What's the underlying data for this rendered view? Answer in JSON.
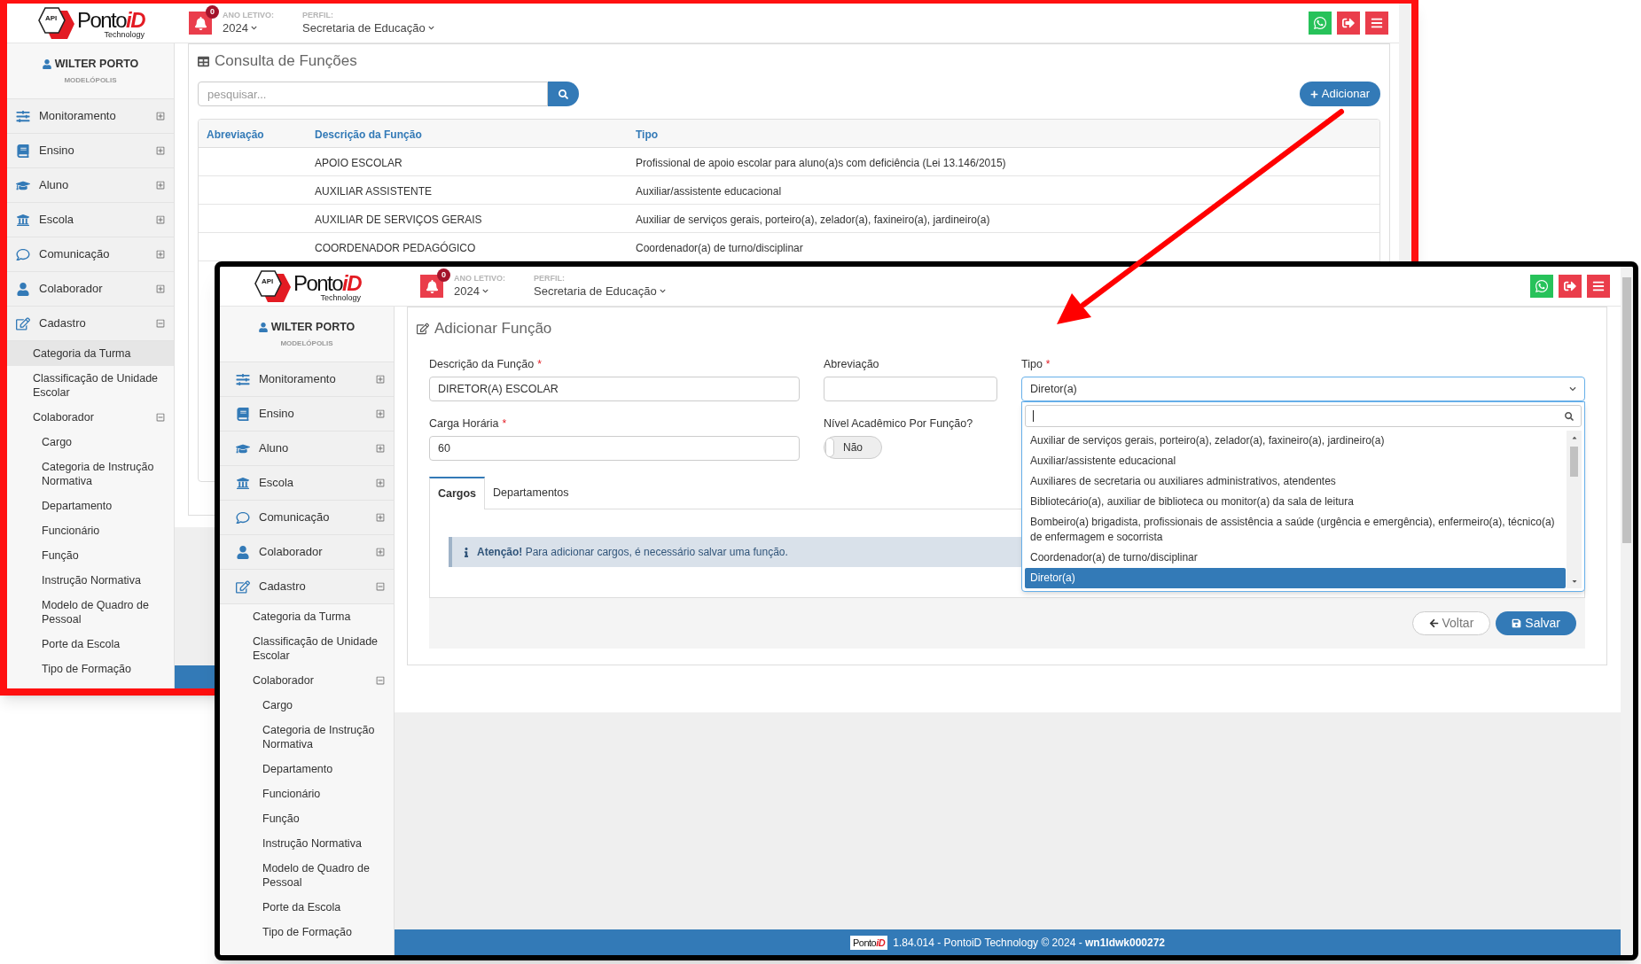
{
  "back_window": {
    "header": {
      "logo": {
        "badge": "API",
        "brand": "Ponto",
        "brand_accent": "iD",
        "tagline": "Technology"
      },
      "notifications": "0",
      "year_label": "ANO LETIVO:",
      "year": "2024",
      "profile_label": "PERFIL:",
      "profile": "Secretaria de Educação"
    },
    "user": {
      "name": "WILTER PORTO",
      "city": "MODELÓPOLIS"
    },
    "sidebar": {
      "items": [
        {
          "label": "Monitoramento",
          "expanded": false
        },
        {
          "label": "Ensino",
          "expanded": false
        },
        {
          "label": "Aluno",
          "expanded": false
        },
        {
          "label": "Escola",
          "expanded": false
        },
        {
          "label": "Comunicação",
          "expanded": false
        },
        {
          "label": "Colaborador",
          "expanded": false
        },
        {
          "label": "Cadastro",
          "expanded": true,
          "children": [
            {
              "label": "Categoria da Turma",
              "selected": true
            },
            {
              "label": "Classificação de Unidade Escolar",
              "selected": false
            },
            {
              "label": "Colaborador",
              "selected": false,
              "expanded": true,
              "children": [
                {
                  "label": "Cargo",
                  "selected": false
                },
                {
                  "label": "Categoria de Instrução Normativa",
                  "selected": false
                },
                {
                  "label": "Departamento",
                  "selected": false
                },
                {
                  "label": "Funcionário",
                  "selected": false
                },
                {
                  "label": "Função",
                  "selected": false
                },
                {
                  "label": "Instrução Normativa",
                  "selected": false
                },
                {
                  "label": "Modelo de Quadro de Pessoal",
                  "selected": false
                },
                {
                  "label": "Porte da Escola",
                  "selected": false
                },
                {
                  "label": "Tipo de Formação",
                  "selected": false
                }
              ]
            }
          ]
        }
      ]
    },
    "page": {
      "title": "Consulta de Funções",
      "search": {
        "placeholder": "pesquisar..."
      },
      "add_button": "Adicionar",
      "table": {
        "columns": [
          "Abreviação",
          "Descrição da Função",
          "Tipo"
        ],
        "rows": [
          {
            "description": "APOIO ESCOLAR",
            "type": "Profissional de apoio escolar para aluno(a)s com deficiência (Lei 13.146/2015)"
          },
          {
            "description": "AUXILIAR ASSISTENTE",
            "type": "Auxiliar/assistente educacional"
          },
          {
            "description": "AUXILIAR DE SERVIÇOS GERAIS",
            "type": "Auxiliar de serviços gerais, porteiro(a), zelador(a), faxineiro(a), jardineiro(a)"
          },
          {
            "description": "COORDENADOR PEDAGÓGICO",
            "type": "Coordenador(a) de turno/disciplinar"
          }
        ]
      }
    }
  },
  "front_window": {
    "header": {
      "logo": {
        "badge": "API",
        "brand": "Ponto",
        "brand_accent": "iD",
        "tagline": "Technology"
      },
      "notifications": "0",
      "year_label": "ANO LETIVO:",
      "year": "2024",
      "profile_label": "PERFIL:",
      "profile": "Secretaria de Educação"
    },
    "user": {
      "name": "WILTER PORTO",
      "city": "MODELÓPOLIS"
    },
    "sidebar": {
      "items": [
        {
          "label": "Monitoramento",
          "expanded": false
        },
        {
          "label": "Ensino",
          "expanded": false
        },
        {
          "label": "Aluno",
          "expanded": false
        },
        {
          "label": "Escola",
          "expanded": false
        },
        {
          "label": "Comunicação",
          "expanded": false
        },
        {
          "label": "Colaborador",
          "expanded": false
        },
        {
          "label": "Cadastro",
          "expanded": true,
          "children": [
            {
              "label": "Categoria da Turma",
              "selected": false
            },
            {
              "label": "Classificação de Unidade Escolar",
              "selected": false
            },
            {
              "label": "Colaborador",
              "selected": false,
              "expanded": true,
              "children": [
                {
                  "label": "Cargo",
                  "selected": false
                },
                {
                  "label": "Categoria de Instrução Normativa",
                  "selected": false
                },
                {
                  "label": "Departamento",
                  "selected": false
                },
                {
                  "label": "Funcionário",
                  "selected": false
                },
                {
                  "label": "Função",
                  "selected": false
                },
                {
                  "label": "Instrução Normativa",
                  "selected": false
                },
                {
                  "label": "Modelo de Quadro de Pessoal",
                  "selected": false
                },
                {
                  "label": "Porte da Escola",
                  "selected": false
                },
                {
                  "label": "Tipo de Formação",
                  "selected": false
                }
              ]
            }
          ]
        }
      ]
    },
    "page": {
      "title": "Adicionar Função",
      "description_field": {
        "label": "Descrição da Função",
        "required_mark": "*",
        "value": "DIRETOR(A) ESCOLAR"
      },
      "abbreviation_field": {
        "label": "Abreviação"
      },
      "type_select": {
        "label": "Tipo",
        "required_mark": "*",
        "value": "Diretor(a)",
        "expanded": true,
        "options": [
          {
            "label": "Auxiliar de serviços gerais, porteiro(a), zelador(a), faxineiro(a), jardineiro(a)",
            "selected": false
          },
          {
            "label": "Auxiliar/assistente educacional",
            "selected": false
          },
          {
            "label": "Auxiliares de secretaria ou auxiliares administrativos, atendentes",
            "selected": false
          },
          {
            "label": "Bibliotecário(a), auxiliar de biblioteca ou monitor(a) da sala de leitura",
            "selected": false
          },
          {
            "label": "Bombeiro(a) brigadista, profissionais de assistência a saúde (urgência e emergência), enfermeiro(a), técnico(a) de enfermagem e socorrista",
            "selected": false
          },
          {
            "label": "Coordenador(a) de turno/disciplinar",
            "selected": false
          },
          {
            "label": "Diretor(a)",
            "selected": true
          }
        ]
      },
      "workload_field": {
        "label": "Carga Horária",
        "required_mark": "*",
        "value": "60"
      },
      "academic_toggle": {
        "label": "Nível Acadêmico Por Função?",
        "on": false,
        "text": "Não"
      },
      "tabs": [
        {
          "label": "Cargos",
          "selected": true
        },
        {
          "label": "Departamentos",
          "selected": false
        }
      ],
      "alert": "**Atenção!** Para adicionar cargos, é necessário salvar uma função.",
      "back_button": "Voltar",
      "save_button": "Salvar"
    },
    "footer": {
      "logo": {
        "brand": "Ponto",
        "brand_accent": "iD"
      },
      "text": "1.84.014 - PontoiD Technology © 2024 - **wn1ldwk000272**"
    }
  }
}
